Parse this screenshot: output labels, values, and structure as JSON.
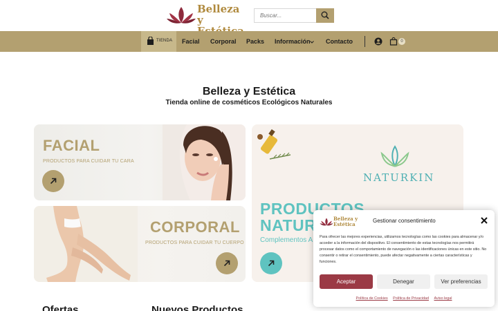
{
  "header": {
    "logo_line1": "Belleza y",
    "logo_line2": "Estética",
    "search_placeholder": "Buscar..."
  },
  "nav": {
    "shop_label": "TIENDA",
    "items": [
      "Facial",
      "Corporal",
      "Packs",
      "Información",
      "Contacto"
    ],
    "cart_count": "0"
  },
  "main": {
    "title": "Belleza y Estética",
    "subtitle": "Tienda online de cosméticos Ecológicos Naturales"
  },
  "cards": {
    "facial": {
      "title": "FACIAL",
      "subtitle": "PRODUCTOS PARA CUIDAR TU CARA"
    },
    "corporal": {
      "title": "CORPORAL",
      "subtitle": "PRODUCTOS PARA CUIDAR TU CUERPO"
    },
    "natural": {
      "title_line1": "PRODUCTOS",
      "title_line2": "NATUR",
      "subtitle": "Complementos A",
      "brand": "NATURKIN"
    }
  },
  "sections": {
    "left": "Ofertas",
    "right": "Nuevos Productos"
  },
  "cookie": {
    "logo_line1": "Belleza y",
    "logo_line2": "Estética",
    "title": "Gestionar consentimiento",
    "body": "Para ofrecer las mejores experiencias, utilizamos tecnologías como las cookies para almacenar y/o acceder a la información del dispositivo. El consentimiento de estas tecnologías nos permitirá procesar datos como el comportamiento de navegación o las identificaciones únicas en este sitio. No consentir o retirar el consentimiento, puede afectar negativamente a ciertas características y funciones.",
    "accept": "Aceptar",
    "deny": "Denegar",
    "prefs": "Ver preferencias",
    "links": [
      "Política de Cookies",
      "Política de Privacidad",
      "Aviso legal"
    ]
  },
  "colors": {
    "brand": "#b3a070",
    "accent": "#9b3a45",
    "teal": "#5fc3c0"
  },
  "icons": [
    "lotus-logo-icon",
    "search-icon",
    "bag-icon",
    "chevron-down-icon",
    "user-icon",
    "cart-icon",
    "arrow-up-right-icon",
    "close-icon"
  ]
}
